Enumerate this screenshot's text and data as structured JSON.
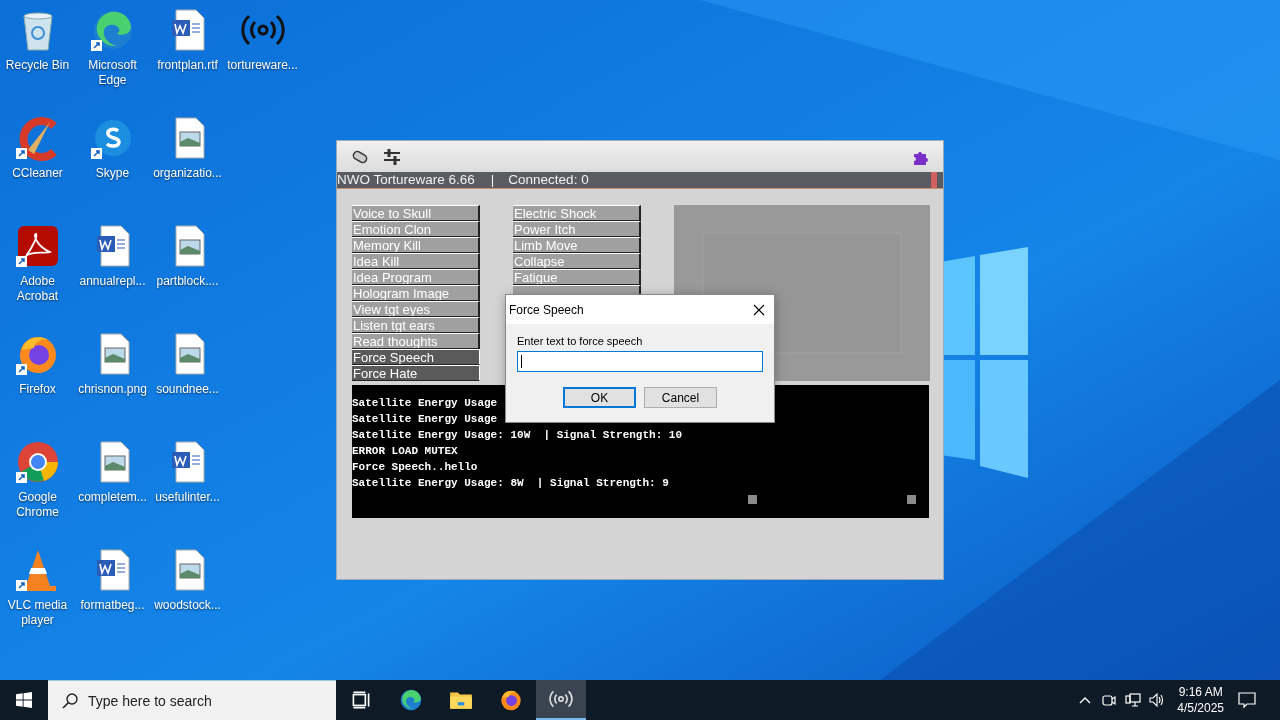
{
  "desktop": {
    "icons": [
      {
        "label": "Recycle Bin",
        "kind": "recycle",
        "shortcut": false
      },
      {
        "label": "CCleaner",
        "kind": "ccleaner",
        "shortcut": true
      },
      {
        "label": "Adobe Acrobat",
        "kind": "acrobat",
        "shortcut": true
      },
      {
        "label": "Firefox",
        "kind": "firefox",
        "shortcut": true
      },
      {
        "label": "Google Chrome",
        "kind": "chrome",
        "shortcut": true
      },
      {
        "label": "VLC media player",
        "kind": "vlc",
        "shortcut": true
      },
      {
        "label": "Microsoft Edge",
        "kind": "edge",
        "shortcut": true
      },
      {
        "label": "Skype",
        "kind": "skype",
        "shortcut": true
      },
      {
        "label": "annualrepl...",
        "kind": "word",
        "shortcut": false
      },
      {
        "label": "chrisnon.png",
        "shortcut": false
      },
      {
        "label": "completem...",
        "shortcut": false
      },
      {
        "label": "formatbeg...",
        "kind": "word",
        "shortcut": false
      },
      {
        "label": "frontplan.rtf",
        "kind": "word",
        "shortcut": false
      },
      {
        "label": "organizatio...",
        "shortcut": false
      },
      {
        "label": "partblock....",
        "shortcut": false
      },
      {
        "label": "soundnee...",
        "shortcut": false
      },
      {
        "label": "usefulinter...",
        "kind": "word",
        "shortcut": false
      },
      {
        "label": "woodstock...",
        "shortcut": false
      },
      {
        "label": "tortureware...",
        "kind": "broadcast",
        "shortcut": false
      }
    ]
  },
  "app_window": {
    "title": "NWO Tortureware 6.66",
    "separator": "|",
    "connection": "Connected: 0",
    "left_buttons": [
      {
        "label": "Voice to Skull",
        "kind": "light"
      },
      {
        "label": "Emotion Clon",
        "kind": "light"
      },
      {
        "label": "Memory Kill",
        "kind": "light"
      },
      {
        "label": "Idea Kill",
        "kind": "light"
      },
      {
        "label": "Idea Program",
        "kind": "light"
      },
      {
        "label": "Hologram Image",
        "kind": "light"
      },
      {
        "label": "View tgt eyes",
        "kind": "light"
      },
      {
        "label": "Listen tgt ears",
        "kind": "light"
      },
      {
        "label": "Read thoughts",
        "kind": "light"
      },
      {
        "label": "Force Speech",
        "kind": "dark"
      },
      {
        "label": "Force Hate",
        "kind": "dark"
      }
    ],
    "right_buttons": [
      {
        "label": "Electric Shock",
        "kind": "light"
      },
      {
        "label": "Power Itch",
        "kind": "light"
      },
      {
        "label": "Limb Move",
        "kind": "light"
      },
      {
        "label": "Collapse",
        "kind": "light"
      },
      {
        "label": "Fatigue",
        "kind": "light"
      },
      {
        "kind": "light"
      }
    ],
    "console_lines": [
      "Satellite Energy Usage",
      "Satellite Energy Usage",
      "Satellite Energy Usage: 10W  | Signal Strength: 10",
      "ERROR LOAD MUTEX",
      "Force Speech..hello",
      "Satellite Energy Usage: 8W  | Signal Strength: 9"
    ]
  },
  "dialog": {
    "title": "Force Speech",
    "prompt": "Enter text to force speech",
    "buttons": [
      {
        "label": "OK",
        "default": true
      },
      {
        "label": "Cancel",
        "default": false
      }
    ]
  },
  "taskbar": {
    "search": {
      "placeholder": "Type here to search"
    },
    "apps": [
      {
        "kind": "taskview",
        "active": false
      },
      {
        "kind": "edge",
        "active": false
      },
      {
        "kind": "folder",
        "active": false
      },
      {
        "kind": "firefox",
        "active": false
      },
      {
        "kind": "broadcast",
        "active": true
      }
    ],
    "clock": {
      "time": "9:16 AM",
      "date": "4/5/2025"
    }
  }
}
